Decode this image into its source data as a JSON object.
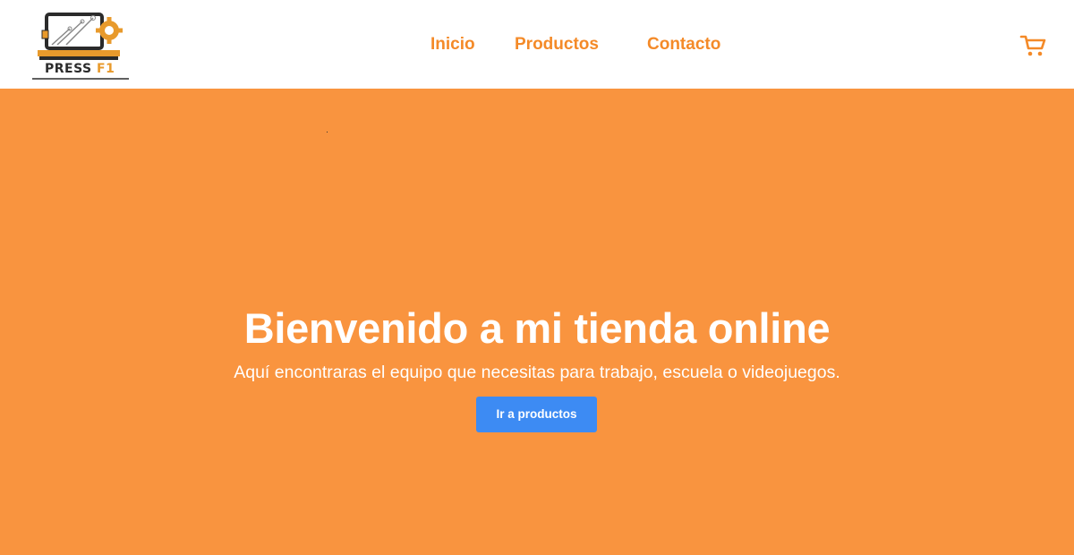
{
  "header": {
    "logo": {
      "text_main": "PRESS ",
      "text_accent": "F1",
      "icon": "laptop-gear-circuit-logo"
    },
    "nav": [
      {
        "label": "Inicio"
      },
      {
        "label": "Productos"
      },
      {
        "label": "Contacto"
      }
    ],
    "cart_icon": "shopping-cart-icon"
  },
  "hero": {
    "title": "Bienvenido a mi tienda online",
    "subtitle": "Aquí encontraras el equipo que necesitas para trabajo, escuela o videojuegos.",
    "button_label": "Ir a productos"
  },
  "colors": {
    "brand_orange": "#f48a28",
    "hero_background": "#f9943f",
    "button_blue": "#3d8bf3",
    "logo_gold": "#e89a2c"
  }
}
